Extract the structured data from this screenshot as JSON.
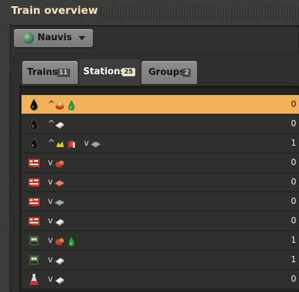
{
  "window": {
    "title": "Train overview"
  },
  "planet_selector": {
    "label": "Nauvis"
  },
  "tabs": [
    {
      "label": "Trains",
      "count": "11"
    },
    {
      "label": "Stations",
      "count": "25"
    },
    {
      "label": "Groups",
      "count": "2"
    }
  ],
  "stations": [
    {
      "station_icon": "crude-oil-icon",
      "items": [
        {
          "dir": "^",
          "icons": [
            "heavy-oil-barrel-icon",
            "green-oil-icon"
          ]
        }
      ],
      "value": "0",
      "selected": true
    },
    {
      "station_icon": "crude-oil-icon",
      "items": [
        {
          "dir": "^",
          "icons": [
            "plastic-bar-icon"
          ]
        }
      ],
      "value": "0",
      "selected": false
    },
    {
      "station_icon": "crude-oil-icon",
      "items": [
        {
          "dir": "^",
          "icons": [
            "sulfur-icon",
            "explosives-icon"
          ]
        },
        {
          "dir": "v",
          "icons": [
            "iron-plate-icon"
          ]
        }
      ],
      "value": "1",
      "selected": false
    },
    {
      "station_icon": "smelter-icon",
      "items": [
        {
          "dir": "v",
          "icons": [
            "copper-ore-icon"
          ]
        }
      ],
      "value": "0",
      "selected": false
    },
    {
      "station_icon": "smelter-icon",
      "items": [
        {
          "dir": "v",
          "icons": [
            "copper-plate-icon"
          ]
        }
      ],
      "value": "0",
      "selected": false
    },
    {
      "station_icon": "smelter-icon",
      "items": [
        {
          "dir": "v",
          "icons": [
            "iron-plate-icon"
          ]
        }
      ],
      "value": "0",
      "selected": false
    },
    {
      "station_icon": "smelter-icon",
      "items": [
        {
          "dir": "v",
          "icons": [
            "plastic-bar-icon"
          ]
        }
      ],
      "value": "0",
      "selected": false
    },
    {
      "station_icon": "assembler-icon",
      "items": [
        {
          "dir": "v",
          "icons": [
            "copper-ore-icon",
            "green-oil-icon"
          ]
        }
      ],
      "value": "1",
      "selected": false
    },
    {
      "station_icon": "assembler-icon",
      "items": [
        {
          "dir": "v",
          "icons": [
            "plastic-bar-icon"
          ]
        }
      ],
      "value": "1",
      "selected": false
    },
    {
      "station_icon": "flask-icon",
      "items": [
        {
          "dir": "v",
          "icons": [
            "plastic-bar-icon"
          ]
        }
      ],
      "value": "0",
      "selected": false
    }
  ],
  "colors": {
    "title": "#ffe6c0",
    "selected_row": "#f2b25a",
    "row": "#2f2f2e"
  }
}
